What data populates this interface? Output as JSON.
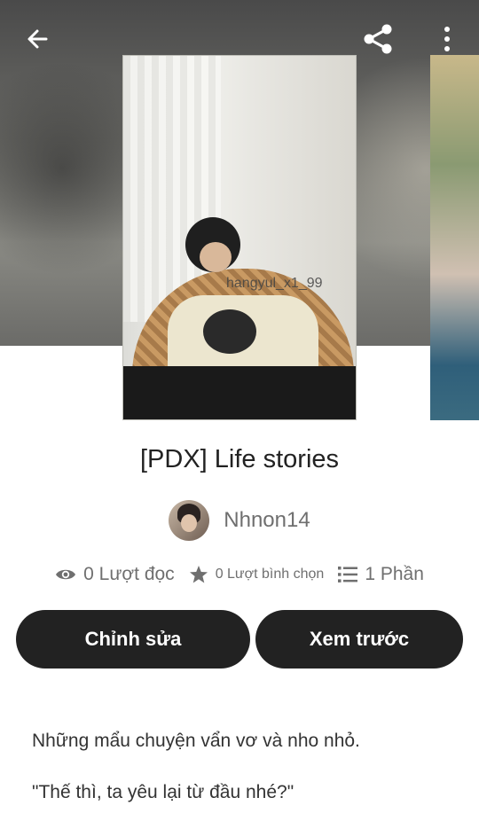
{
  "cover": {
    "watermark": "hangyul_x1_99"
  },
  "story": {
    "title": "[PDX] Life stories",
    "author": "Nhnon14"
  },
  "stats": {
    "reads": "0 Lượt đọc",
    "votes": "0 Lượt bình chọn",
    "parts": "1 Phần"
  },
  "actions": {
    "edit_label": "Chỉnh sửa",
    "preview_label": "Xem trước"
  },
  "description": {
    "line1": "Những mẩu chuyện vẩn vơ và nho nhỏ.",
    "line2": "\"Thế thì, ta yêu lại từ đầu nhé?\""
  },
  "colors": {
    "button_bg": "#222222",
    "button_text": "#ffffff",
    "secondary_text": "#6f6f6f"
  },
  "icons": [
    "back-arrow-icon",
    "share-icon",
    "more-vertical-icon",
    "eye-icon",
    "star-icon",
    "list-icon"
  ]
}
